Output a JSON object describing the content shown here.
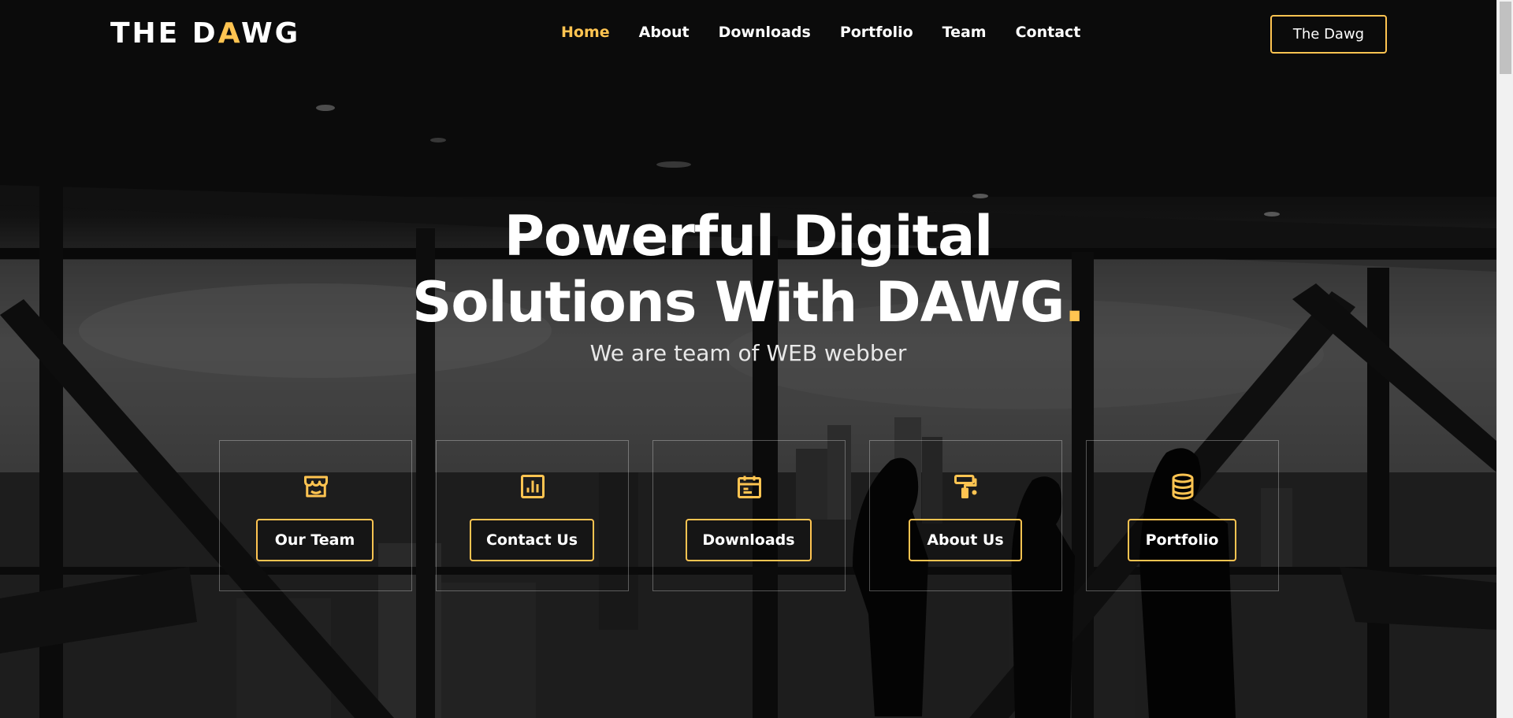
{
  "header": {
    "logo_prefix": "THE D",
    "logo_accent": "A",
    "logo_suffix": "WG",
    "nav": [
      {
        "label": "Home",
        "active": true
      },
      {
        "label": "About"
      },
      {
        "label": "Downloads"
      },
      {
        "label": "Portfolio"
      },
      {
        "label": "Team"
      },
      {
        "label": "Contact"
      }
    ],
    "cta_label": "The Dawg"
  },
  "hero": {
    "title_line1": "Powerful Digital",
    "title_line2": "Solutions With DAWG",
    "title_dot": ".",
    "subtitle": "We are team of WEB webber"
  },
  "features": [
    {
      "label": "Our Team",
      "icon": "store-icon"
    },
    {
      "label": "Contact Us",
      "icon": "bar-chart-icon"
    },
    {
      "label": "Downloads",
      "icon": "calendar-icon"
    },
    {
      "label": "About Us",
      "icon": "paint-roller-icon"
    },
    {
      "label": "Portfolio",
      "icon": "database-icon"
    }
  ],
  "colors": {
    "accent": "#ffc451",
    "background": "#0b0b0b",
    "text": "#ffffff"
  }
}
